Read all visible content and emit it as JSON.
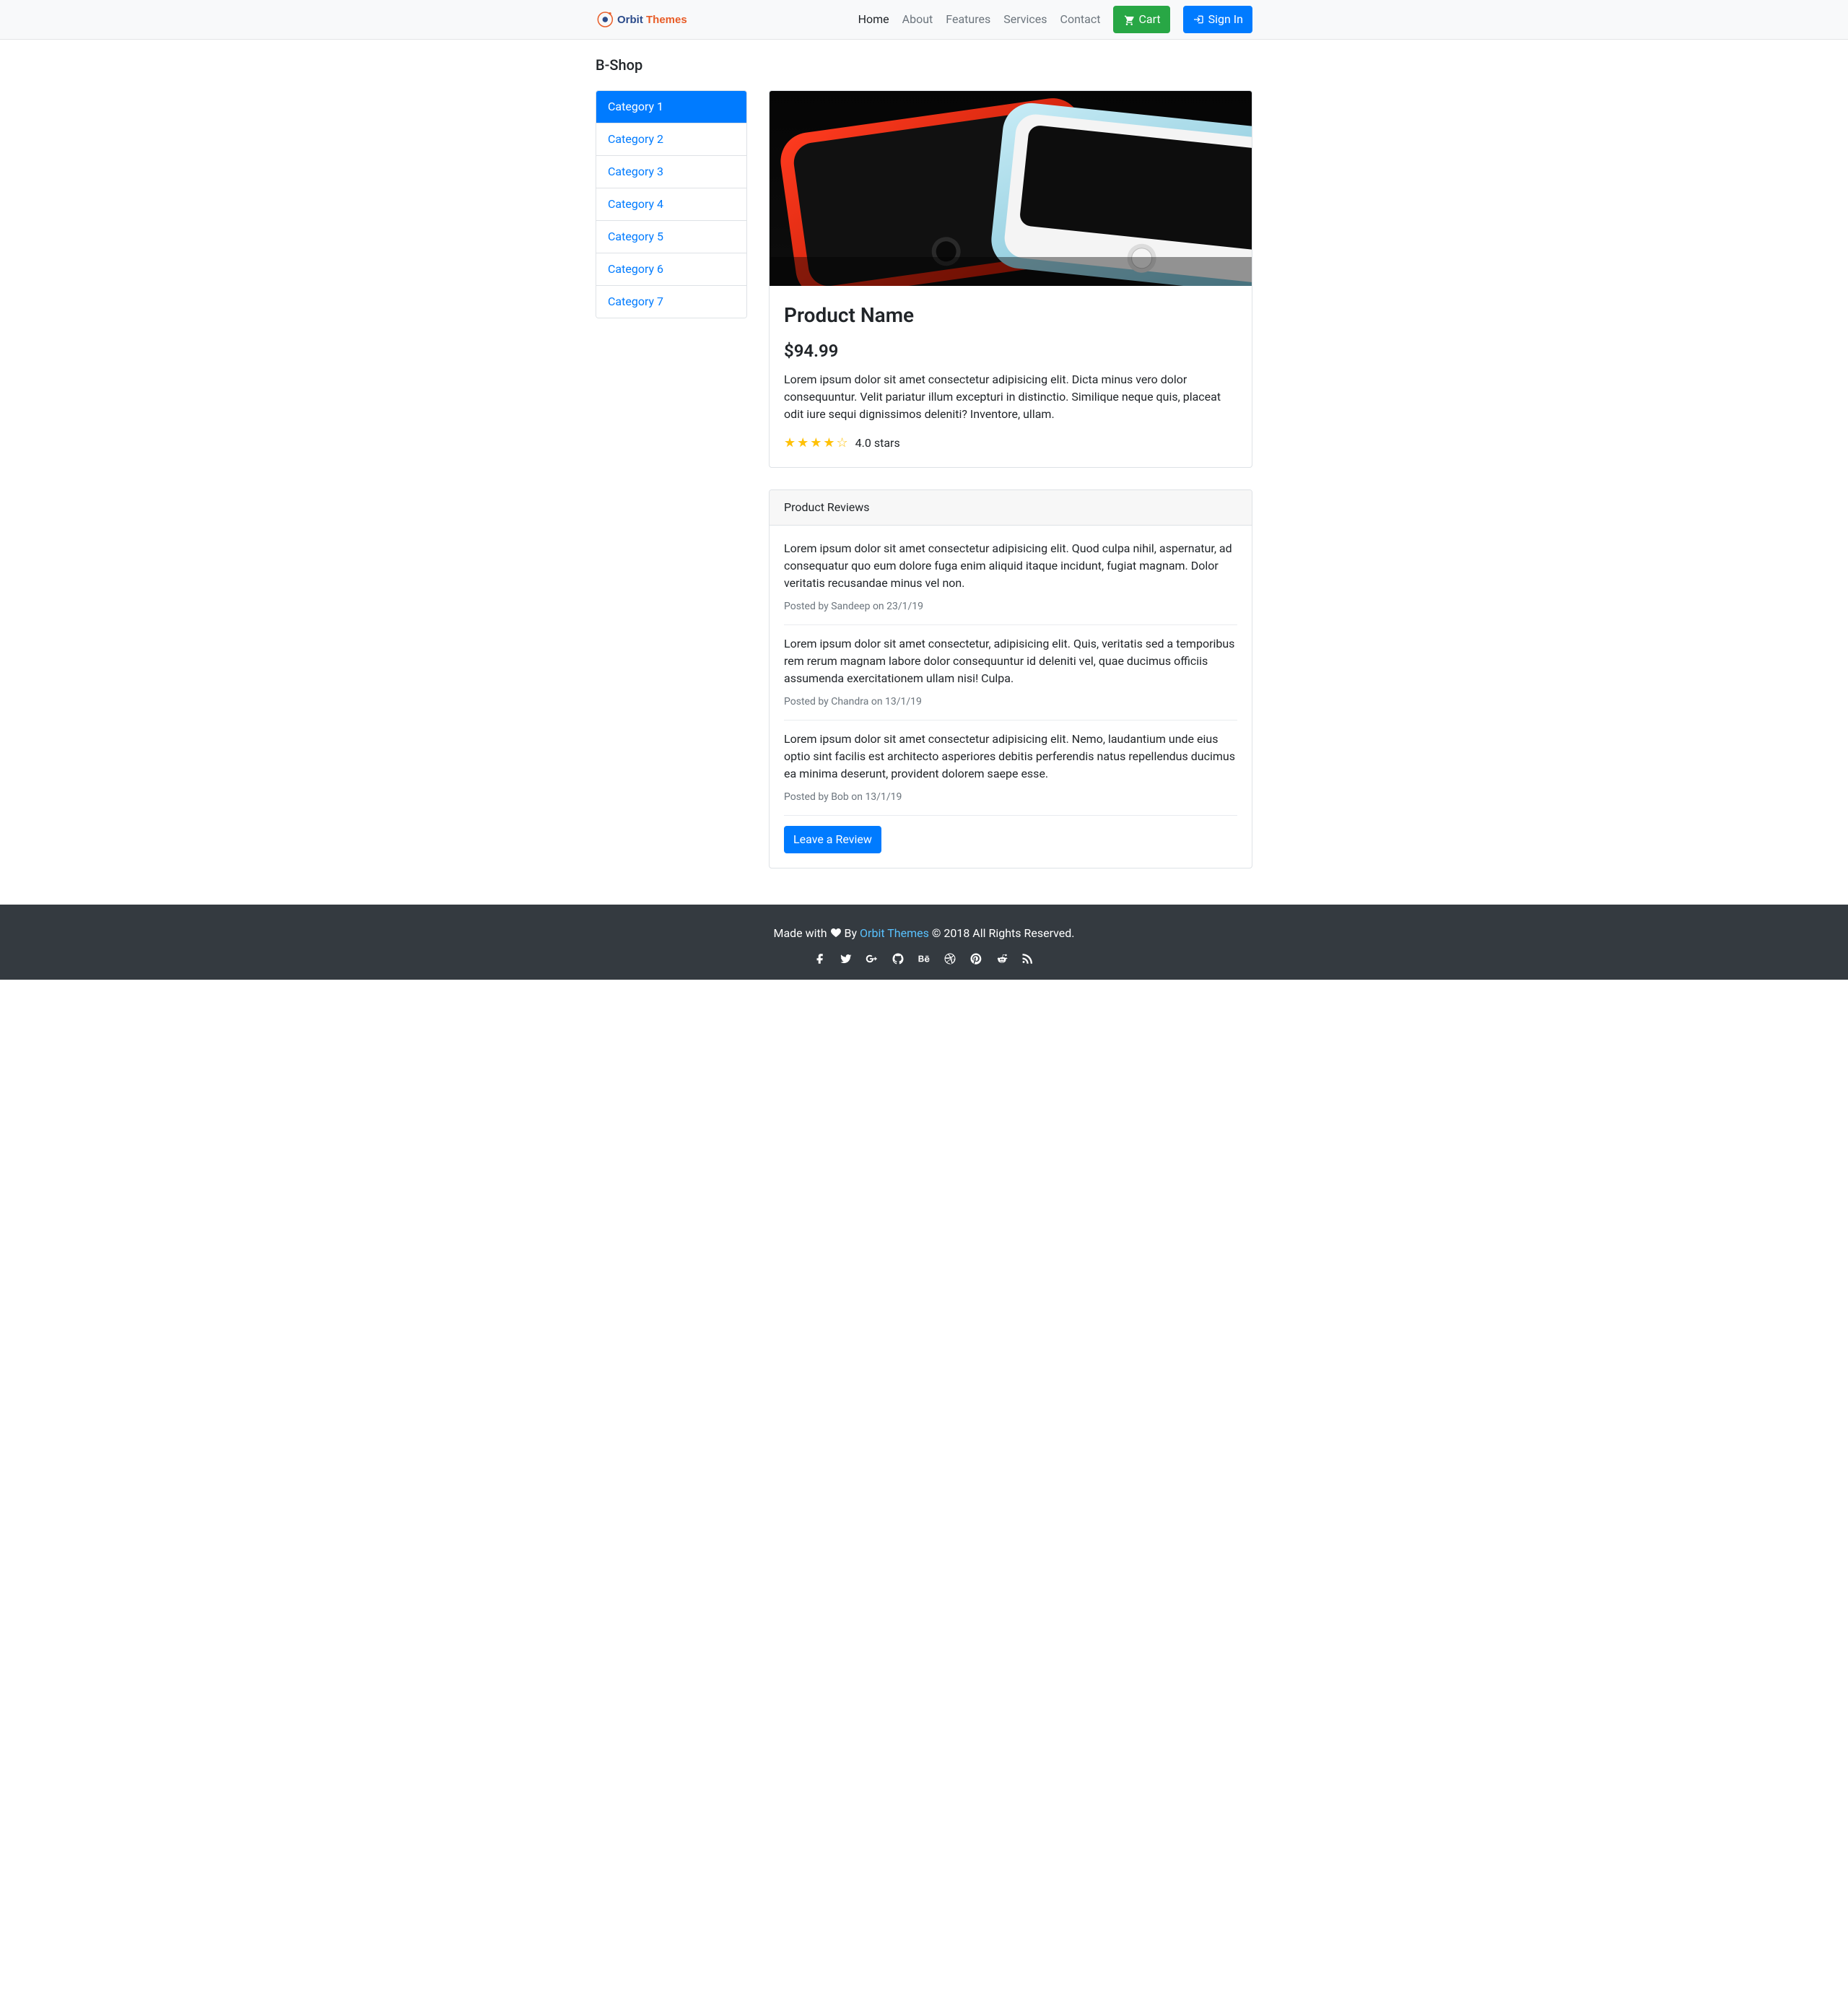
{
  "nav": {
    "links": [
      {
        "label": "Home",
        "active": true
      },
      {
        "label": "About",
        "active": false
      },
      {
        "label": "Features",
        "active": false
      },
      {
        "label": "Services",
        "active": false
      },
      {
        "label": "Contact",
        "active": false
      }
    ],
    "cart_label": "Cart",
    "signin_label": "Sign In"
  },
  "page": {
    "heading": "B-Shop"
  },
  "sidebar": {
    "categories": [
      {
        "label": "Category 1",
        "active": true
      },
      {
        "label": "Category 2",
        "active": false
      },
      {
        "label": "Category 3",
        "active": false
      },
      {
        "label": "Category 4",
        "active": false
      },
      {
        "label": "Category 5",
        "active": false
      },
      {
        "label": "Category 6",
        "active": false
      },
      {
        "label": "Category 7",
        "active": false
      }
    ]
  },
  "product": {
    "name": "Product Name",
    "price": "$94.99",
    "description": "Lorem ipsum dolor sit amet consectetur adipisicing elit. Dicta minus vero dolor consequuntur. Velit pariatur illum excepturi in distinctio. Similique neque quis, placeat odit iure sequi dignissimos deleniti? Inventore, ullam.",
    "stars_filled": 4,
    "stars_total": 5,
    "stars_text": "4.0 stars"
  },
  "reviews": {
    "heading": "Product Reviews",
    "items": [
      {
        "text": "Lorem ipsum dolor sit amet consectetur adipisicing elit. Quod culpa nihil, aspernatur, ad consequatur quo eum dolore fuga enim aliquid itaque incidunt, fugiat magnam. Dolor veritatis recusandae minus vel non.",
        "meta": "Posted by Sandeep on 23/1/19"
      },
      {
        "text": "Lorem ipsum dolor sit amet consectetur, adipisicing elit. Quis, veritatis sed a temporibus rem rerum magnam labore dolor consequuntur id deleniti vel, quae ducimus officiis assumenda exercitationem ullam nisi! Culpa.",
        "meta": "Posted by Chandra on 13/1/19"
      },
      {
        "text": "Lorem ipsum dolor sit amet consectetur adipisicing elit. Nemo, laudantium unde eius optio sint facilis est architecto asperiores debitis perferendis natus repellendus ducimus ea minima deserunt, provident dolorem saepe esse.",
        "meta": "Posted by Bob on 13/1/19"
      }
    ],
    "leave_button": "Leave a Review"
  },
  "footer": {
    "made_prefix": "Made with ",
    "by_text": " By ",
    "brand": "Orbit Themes",
    "copyright": " © 2018 All Rights Reserved."
  }
}
